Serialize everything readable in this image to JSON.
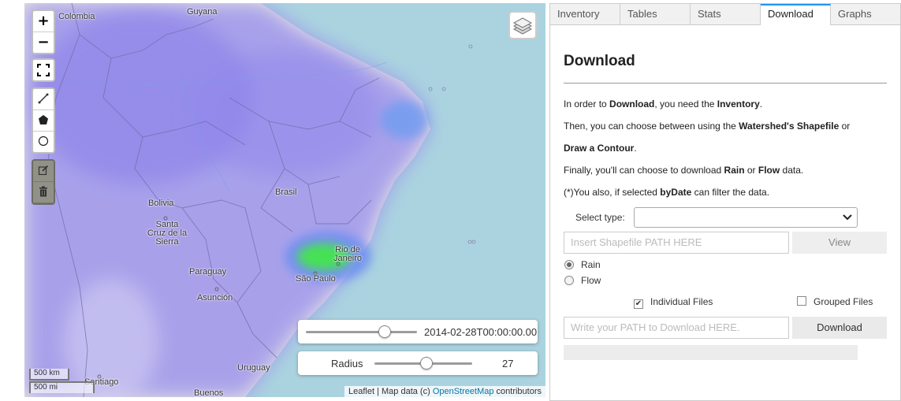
{
  "map": {
    "places": {
      "colombia": "Colombia",
      "guyana": "Guyana",
      "bolivia": "Bolivia",
      "brasil": "Brasil",
      "santa_cruz": "Santa Cruz de la Sierra",
      "paraguay": "Paraguay",
      "asuncion": "Asunción",
      "sao_paulo": "São Paulo",
      "rio": "Rio de Janeiro",
      "uruguay": "Uruguay",
      "santiago": "Santiago",
      "buenos": "Buenos"
    },
    "zoom_in": "+",
    "zoom_out": "−",
    "time_slider": {
      "value_text": "2014-02-28T00:00:00.00",
      "position": 0.71
    },
    "radius_slider": {
      "label": "Radius",
      "value": "27",
      "position": 0.53
    },
    "scale": {
      "km": "500 km",
      "mi": "500 mi"
    },
    "attribution": {
      "leaflet": "Leaflet",
      "sep": " | Map data (c) ",
      "osm": "OpenStreetMap",
      "contributors": " contributors"
    },
    "icons": [
      "fullscreen-icon",
      "polyline-icon",
      "polygon-icon",
      "circle-icon",
      "edit-icon",
      "trash-icon",
      "layers-icon"
    ]
  },
  "panel": {
    "tabs": [
      {
        "label": "Inventory"
      },
      {
        "label": "Tables"
      },
      {
        "label": "Stats"
      },
      {
        "label": "Download",
        "active": true
      },
      {
        "label": "Graphs"
      }
    ],
    "heading": "Download",
    "p1": {
      "a": "In order to ",
      "b": "Download",
      "c": ", you need the ",
      "d": "Inventory",
      "e": "."
    },
    "p2": {
      "a": "Then, you can choose between using the ",
      "b": "Watershed's Shapefile",
      "c": " or"
    },
    "p3": {
      "b": "Draw a Contour",
      "c": "."
    },
    "p4": {
      "a": "Finally, you'll can choose to download ",
      "b": "Rain",
      "c": " or ",
      "d": "Flow",
      "e": " data."
    },
    "p5": {
      "a": "(*)You also, if selected ",
      "b": "byDate",
      "c": " can filter the data."
    },
    "select_label": "Select type:",
    "select_value": "",
    "shapefile_placeholder": "Insert Shapefile PATH HERE",
    "view_button": "View",
    "radio_rain": "Rain",
    "radio_flow": "Flow",
    "radio_selected": "Rain",
    "check_individual": "Individual Files",
    "check_individual_checked": true,
    "check_grouped": "Grouped Files",
    "check_grouped_checked": false,
    "path_placeholder": "Write your PATH to Download HERE.",
    "download_button": "Download",
    "progress": 0
  },
  "colors": {
    "tab_accent": "#2196f3",
    "heat_low": "#8a7ff0",
    "heat_high": "#3ef03a",
    "water": "#aad3df"
  }
}
